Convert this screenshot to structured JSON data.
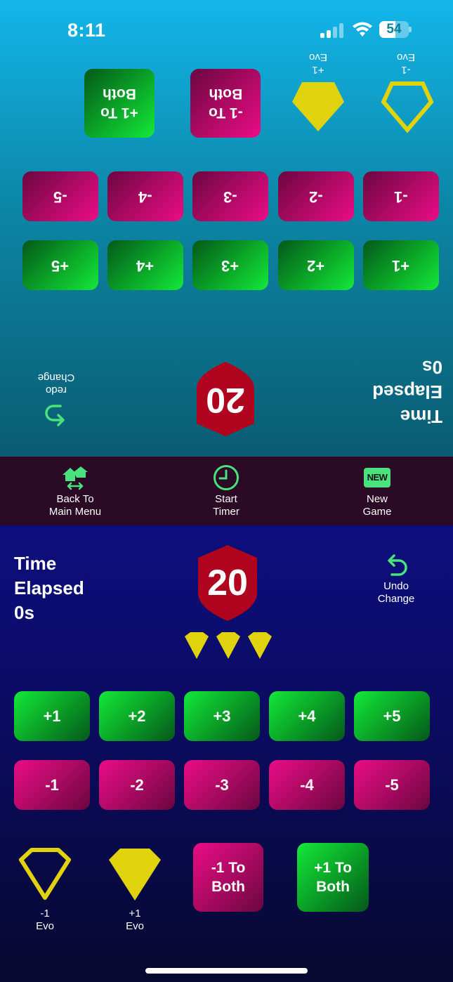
{
  "status_bar": {
    "time": "8:11",
    "battery": "54",
    "battery_level": 0.54
  },
  "colors": {
    "green": "#14e83a",
    "pink": "#ea0c86",
    "shield": "#b0041e",
    "evo_yellow": "#e0d20c",
    "undo_green": "#49e27c",
    "menu_bg": "#2a0a24"
  },
  "opponent": {
    "time_label": "Time\nElapsed",
    "time_value": "0s",
    "life": "20",
    "redo_label": "redo\nChange",
    "plus_buttons": [
      "+1",
      "+2",
      "+3",
      "+4",
      "+5"
    ],
    "minus_buttons": [
      "-1",
      "-2",
      "-3",
      "-4",
      "-5"
    ],
    "evo_minus_label": "-1\nEvo",
    "evo_plus_label": "+1\nEvo",
    "minus_both": "-1 To\nBoth",
    "plus_both": "+1 To\nBoth"
  },
  "menu": {
    "back_label": "Back To\nMain Menu",
    "back_icon": "home-arrows-icon",
    "timer_label": "Start\nTimer",
    "timer_icon": "clock-icon",
    "new_label": "New\nGame",
    "new_icon": "new-badge-icon",
    "new_badge_text": "NEW"
  },
  "player": {
    "time_label": "Time\nElapsed",
    "time_value": "0s",
    "life": "20",
    "undo_label": "Undo\nChange",
    "evo_counters": 3,
    "plus_buttons": [
      "+1",
      "+2",
      "+3",
      "+4",
      "+5"
    ],
    "minus_buttons": [
      "-1",
      "-2",
      "-3",
      "-4",
      "-5"
    ],
    "evo_minus_label": "-1\nEvo",
    "evo_plus_label": "+1\nEvo",
    "minus_both": "-1 To\nBoth",
    "plus_both": "+1 To\nBoth"
  }
}
